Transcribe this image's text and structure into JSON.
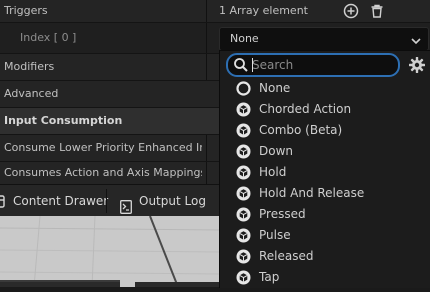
{
  "details": {
    "triggers_label": "Triggers",
    "triggers_value": "1 Array element",
    "index_label": "Index [ 0 ]",
    "index_value": "None",
    "modifiers_label": "Modifiers",
    "advanced_label": "Advanced",
    "input_consumption_label": "Input Consumption",
    "consume_lower_label": "Consume Lower Priority Enhanced Inp...",
    "consumes_action_label": "Consumes Action and Axis Mappings"
  },
  "toolbar": {
    "content_drawer_label": "Content Drawer",
    "output_log_label": "Output Log"
  },
  "dropdown": {
    "search_placeholder": "Search",
    "options": [
      {
        "label": "None",
        "icon": "none-icon"
      },
      {
        "label": "Chorded Action",
        "icon": "trigger-class-icon"
      },
      {
        "label": "Combo (Beta)",
        "icon": "trigger-class-icon"
      },
      {
        "label": "Down",
        "icon": "trigger-class-icon"
      },
      {
        "label": "Hold",
        "icon": "trigger-class-icon"
      },
      {
        "label": "Hold And Release",
        "icon": "trigger-class-icon"
      },
      {
        "label": "Pressed",
        "icon": "trigger-class-icon"
      },
      {
        "label": "Pulse",
        "icon": "trigger-class-icon"
      },
      {
        "label": "Released",
        "icon": "trigger-class-icon"
      },
      {
        "label": "Tap",
        "icon": "trigger-class-icon"
      }
    ]
  },
  "colors": {
    "focus_accent": "#2d6fb3",
    "panel_bg": "#242424",
    "popup_bg": "#1c1c1c"
  }
}
